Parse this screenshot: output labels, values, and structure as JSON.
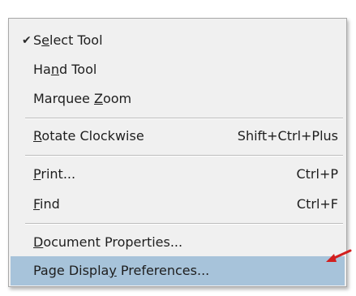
{
  "menu": {
    "items": [
      {
        "pre": "S",
        "mnemonic": "e",
        "post": "lect Tool",
        "shortcut": "",
        "checked": true
      },
      {
        "pre": "Ha",
        "mnemonic": "n",
        "post": "d Tool",
        "shortcut": "",
        "checked": false
      },
      {
        "pre": "Marquee ",
        "mnemonic": "Z",
        "post": "oom",
        "shortcut": "",
        "checked": false
      },
      {
        "pre": "",
        "mnemonic": "R",
        "post": "otate Clockwise",
        "shortcut": "Shift+Ctrl+Plus",
        "checked": false
      },
      {
        "pre": "",
        "mnemonic": "P",
        "post": "rint...",
        "shortcut": "Ctrl+P",
        "checked": false
      },
      {
        "pre": "",
        "mnemonic": "F",
        "post": "ind",
        "shortcut": "Ctrl+F",
        "checked": false
      },
      {
        "pre": "",
        "mnemonic": "D",
        "post": "ocument Properties...",
        "shortcut": "",
        "checked": false
      },
      {
        "pre": "Page Displa",
        "mnemonic": "y",
        "post": " Preferences...",
        "shortcut": "",
        "checked": false
      }
    ],
    "check_glyph": "✔",
    "highlight_color": "#a7c3da",
    "highlighted_index": 7
  },
  "annotation": {
    "arrow_color": "#d21f1f"
  }
}
